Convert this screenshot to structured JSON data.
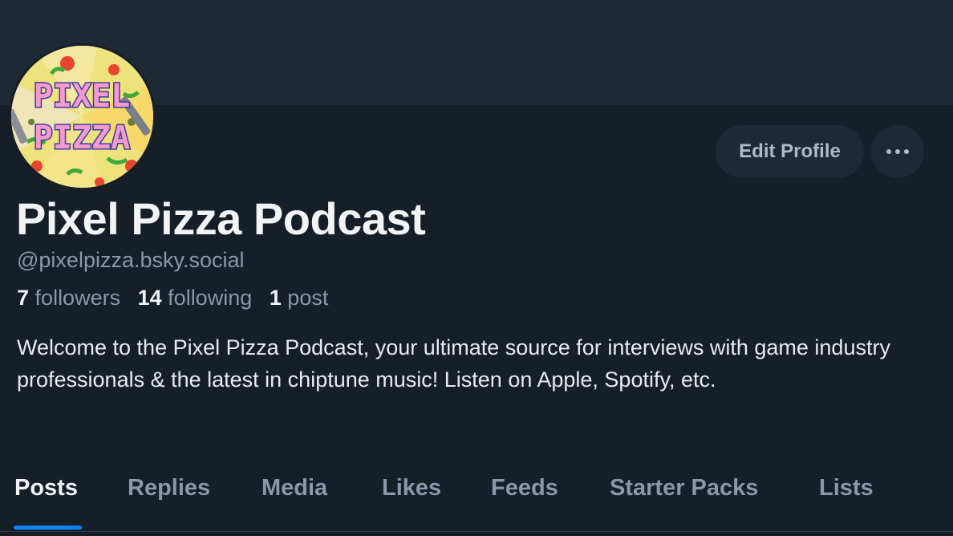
{
  "profile": {
    "display_name": "Pixel Pizza Podcast",
    "handle": "@pixelpizza.bsky.social",
    "avatar_text_line1": "PIXEL",
    "avatar_text_line2": "PIZZA",
    "bio": "Welcome to the Pixel Pizza Podcast, your ultimate source for interviews with game industry professionals & the latest in chiptune music! Listen on Apple, Spotify, etc."
  },
  "stats": {
    "followers_count": "7",
    "followers_label": "followers",
    "following_count": "14",
    "following_label": "following",
    "posts_count": "1",
    "posts_label": "post"
  },
  "actions": {
    "edit_profile_label": "Edit Profile",
    "more_icon": "ellipsis-icon"
  },
  "tabs": [
    {
      "label": "Posts",
      "active": true
    },
    {
      "label": "Replies",
      "active": false
    },
    {
      "label": "Media",
      "active": false
    },
    {
      "label": "Likes",
      "active": false
    },
    {
      "label": "Feeds",
      "active": false
    },
    {
      "label": "Starter Packs",
      "active": false
    },
    {
      "label": "Lists",
      "active": false
    }
  ],
  "colors": {
    "background": "#161e27",
    "banner": "#1e2936",
    "accent": "#1083fe",
    "text_primary": "#f1f3f5",
    "text_secondary": "#8a98a8"
  }
}
